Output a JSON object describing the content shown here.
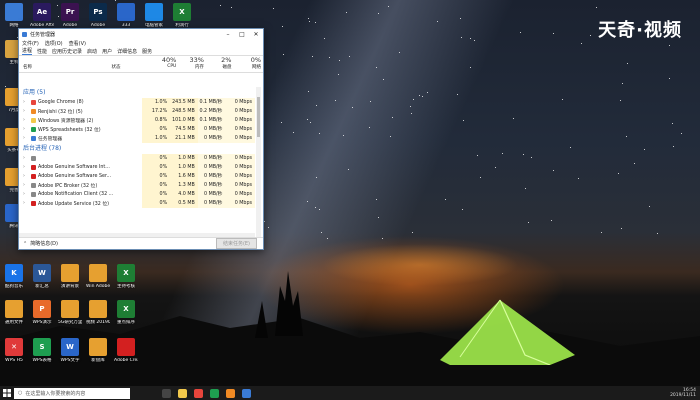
{
  "watermark": "天奇·视频",
  "desktop_icons": [
    {
      "label": "网络",
      "icon": "network-icon",
      "color": "#3a7bd5"
    },
    {
      "label": "Adobe After",
      "icon": "after-effects-icon",
      "color": "#2a1a5e",
      "glyph": "Ae"
    },
    {
      "label": "Adobe",
      "icon": "premiere-icon",
      "color": "#3b1250",
      "glyph": "Pr"
    },
    {
      "label": "Adobe",
      "icon": "photoshop-icon",
      "color": "#0b2a4a",
      "glyph": "Ps"
    },
    {
      "label": "333",
      "icon": "folder-icon",
      "color": "#2a66c9"
    },
    {
      "label": "电脑管家",
      "icon": "shield-icon",
      "color": "#1e88e5"
    },
    {
      "label": "利润行",
      "icon": "excel-icon",
      "color": "#1e7e34",
      "glyph": "X"
    },
    {
      "label": "主机",
      "icon": "computer-icon",
      "color": "#d9a441"
    },
    {
      "label": "7月度",
      "icon": "doc-icon",
      "color": "#e6a030"
    },
    {
      "label": "头条号",
      "icon": "doc-icon",
      "color": "#e6a030"
    },
    {
      "label": "完善",
      "icon": "doc-icon",
      "color": "#e6a030"
    },
    {
      "label": "腾讯",
      "icon": "tencent-icon",
      "color": "#2a66c9"
    },
    {
      "label": "酷狗音乐",
      "icon": "kugou-icon",
      "color": "#1a73e8",
      "glyph": "K"
    },
    {
      "label": "新汇总",
      "icon": "word-icon",
      "color": "#2b5797",
      "glyph": "W"
    },
    {
      "label": "演讲背景",
      "icon": "doc-icon",
      "color": "#e6a030"
    },
    {
      "label": "Win Adobe cc 2018 注...",
      "icon": "doc-icon",
      "color": "#e6a030"
    },
    {
      "label": "主待考核",
      "icon": "excel-icon",
      "color": "#1e7e34",
      "glyph": "X"
    },
    {
      "label": "通用文件",
      "icon": "doc-icon",
      "color": "#e6a030"
    },
    {
      "label": "WPS演示",
      "icon": "wps-ppt-icon",
      "color": "#e86a2a",
      "glyph": "P"
    },
    {
      "label": "5G研究万里 万卷影...",
      "icon": "doc-icon",
      "color": "#e6a030"
    },
    {
      "label": "视频 2019091...",
      "icon": "doc-icon",
      "color": "#e6a030"
    },
    {
      "label": "重点排序",
      "icon": "excel-icon",
      "color": "#1e7e34",
      "glyph": "X"
    },
    {
      "label": "WPS H5",
      "icon": "wps-h5-icon",
      "color": "#e03a3a",
      "glyph": "✕"
    },
    {
      "label": "WPS表格",
      "icon": "wps-sheet-icon",
      "color": "#1e9e50",
      "glyph": "S"
    },
    {
      "label": "WPS文字",
      "icon": "wps-writer-icon",
      "color": "#2a66c9",
      "glyph": "W"
    },
    {
      "label": "新盘库",
      "icon": "doc-icon",
      "color": "#e6a030"
    },
    {
      "label": "Adobe Creati...",
      "icon": "creative-cloud-icon",
      "color": "#d32020"
    }
  ],
  "task_manager": {
    "title": "任务管理器",
    "menu": [
      "文件(F)",
      "选项(O)",
      "查看(V)"
    ],
    "tabs": [
      "进程",
      "性能",
      "应用历史记录",
      "启动",
      "用户",
      "详细信息",
      "服务"
    ],
    "columns": {
      "name": "名称",
      "status": "状态",
      "cpu": {
        "pct": "40%",
        "label": "CPU"
      },
      "memory": {
        "pct": "33%",
        "label": "内存"
      },
      "disk": {
        "pct": "2%",
        "label": "磁盘"
      },
      "network": {
        "pct": "0%",
        "label": "网络"
      }
    },
    "groups": [
      {
        "title": "应用 (5)",
        "rows": [
          {
            "name": "Google Chrome (8)",
            "cpu": "1.0%",
            "mem": "243.5 MB",
            "disk": "0.1 MB/秒",
            "net": "0 Mbps",
            "icon": "chrome-icon",
            "color": "#e8453c"
          },
          {
            "name": "Renjishi (32 位) (5)",
            "cpu": "17.2%",
            "mem": "248.5 MB",
            "disk": "0.2 MB/秒",
            "net": "0 Mbps",
            "icon": "app-icon",
            "color": "#f08a24"
          },
          {
            "name": "Windows 资源管理器 (2)",
            "cpu": "0.8%",
            "mem": "101.0 MB",
            "disk": "0.1 MB/秒",
            "net": "0 Mbps",
            "icon": "explorer-icon",
            "color": "#f2c94c"
          },
          {
            "name": "WPS Spreadsheets (32 位)",
            "cpu": "0%",
            "mem": "74.5 MB",
            "disk": "0 MB/秒",
            "net": "0 Mbps",
            "icon": "wps-sheet-icon",
            "color": "#1e9e50"
          },
          {
            "name": "任务管理器",
            "cpu": "1.0%",
            "mem": "21.1 MB",
            "disk": "0 MB/秒",
            "net": "0 Mbps",
            "icon": "taskmgr-icon",
            "color": "#3a7bd5"
          }
        ]
      },
      {
        "title": "后台进程 (78)",
        "rows": [
          {
            "name": "",
            "cpu": "0%",
            "mem": "1.0 MB",
            "disk": "0 MB/秒",
            "net": "0 Mbps",
            "icon": "app-icon",
            "color": "#888"
          },
          {
            "name": "Adobe Genuine Software Int...",
            "cpu": "0%",
            "mem": "1.0 MB",
            "disk": "0 MB/秒",
            "net": "0 Mbps",
            "icon": "adobe-icon",
            "color": "#d32020"
          },
          {
            "name": "Adobe Genuine Software Ser...",
            "cpu": "0%",
            "mem": "1.6 MB",
            "disk": "0 MB/秒",
            "net": "0 Mbps",
            "icon": "adobe-icon",
            "color": "#d32020"
          },
          {
            "name": "Adobe IPC Broker (32 位)",
            "cpu": "0%",
            "mem": "1.3 MB",
            "disk": "0 MB/秒",
            "net": "0 Mbps",
            "icon": "adobe-icon",
            "color": "#888"
          },
          {
            "name": "Adobe Notification Client (32 ...",
            "cpu": "0%",
            "mem": "4.0 MB",
            "disk": "0 MB/秒",
            "net": "0 Mbps",
            "icon": "adobe-icon",
            "color": "#888"
          },
          {
            "name": "Adobe Update Service (32 位)",
            "cpu": "0%",
            "mem": "0.5 MB",
            "disk": "0 MB/秒",
            "net": "0 Mbps",
            "icon": "adobe-icon",
            "color": "#d32020"
          }
        ]
      }
    ],
    "footer_label": "简略信息(D)",
    "end_task": "结束任务(E)"
  },
  "taskbar": {
    "search_placeholder": "在这里输入你要搜索的内容",
    "time": "16:54",
    "date": "2019/11/11"
  }
}
